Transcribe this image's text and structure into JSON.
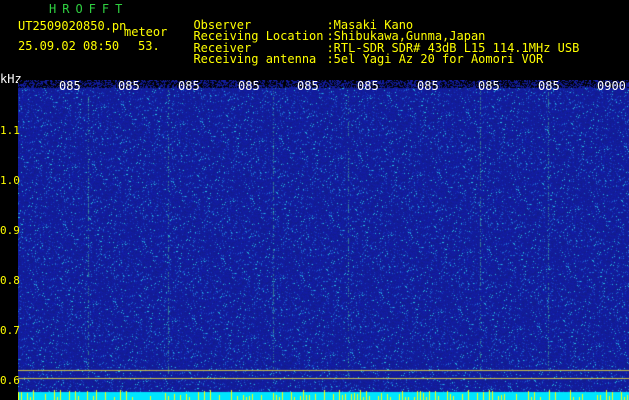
{
  "header": {
    "title": "HROFFT",
    "filename": "UT2509020850.pn",
    "filename_suffix": "meteor",
    "datetime": "25.09.02 08:50",
    "count": "53.",
    "info": [
      {
        "label": "Observer",
        "value": ":Masaki Kano"
      },
      {
        "label": "Receiving Location",
        "value": ":Shibukawa,Gunma,Japan"
      },
      {
        "label": "Receiver",
        "value": ":RTL-SDR SDR# 43dB L15 114.1MHz USB"
      },
      {
        "label": "Receiving antenna",
        "value": ":5el Yagi Az 20 for Aomori VOR"
      }
    ]
  },
  "y_axis": {
    "unit": "kHz",
    "ticks": [
      "1.1",
      "1.0",
      "0.9",
      "0.8",
      "0.7",
      "0.6"
    ]
  },
  "x_axis": {
    "ticks": [
      "085",
      "085",
      "085",
      "085",
      "085",
      "085",
      "085",
      "085",
      "085",
      "0900"
    ]
  },
  "colors": {
    "background": "#000000",
    "waterfall_base": "#1a2494",
    "axis_text": "#ffff00",
    "title_text": "#2fd040",
    "bottom_band": "#00e5ff"
  }
}
